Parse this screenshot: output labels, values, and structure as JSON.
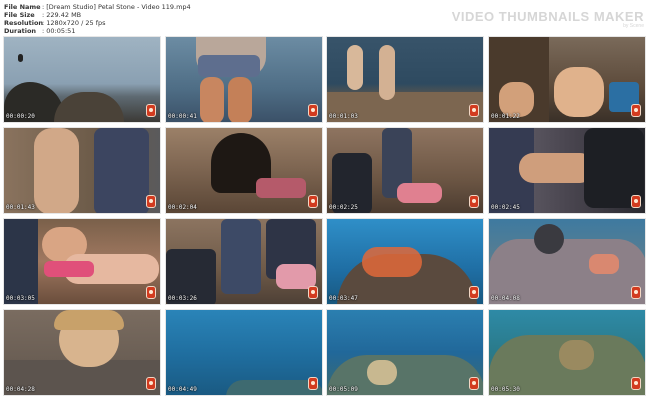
{
  "header": {
    "rows": [
      {
        "label": "File Name",
        "value": ": [Dream Studio] Petal Stone - Video 119.mp4"
      },
      {
        "label": "File Size",
        "value": ": 229.42 MB"
      },
      {
        "label": "Resolution",
        "value": ": 1280x720 / 25 fps"
      },
      {
        "label": "Duration",
        "value": ": 00:05:51"
      }
    ],
    "brand": "VIDEO THUMBNAILS MAKER",
    "brand_sub": "by Scene"
  },
  "thumbnails": [
    {
      "timestamp": "00:00:20",
      "scene": "rocky-shore-birds"
    },
    {
      "timestamp": "00:00:41",
      "scene": "person-standing-sea"
    },
    {
      "timestamp": "00:01:03",
      "scene": "two-people-rocks"
    },
    {
      "timestamp": "00:01:22",
      "scene": "people-in-cave"
    },
    {
      "timestamp": "00:01:43",
      "scene": "person-near-fins"
    },
    {
      "timestamp": "00:02:04",
      "scene": "cave-entrance"
    },
    {
      "timestamp": "00:02:25",
      "scene": "wetsuit-figures"
    },
    {
      "timestamp": "00:02:45",
      "scene": "wetsuit-closeup"
    },
    {
      "timestamp": "00:03:05",
      "scene": "face-on-towel"
    },
    {
      "timestamp": "00:03:26",
      "scene": "wetsuits-hanging"
    },
    {
      "timestamp": "00:03:47",
      "scene": "reef-orange-fish"
    },
    {
      "timestamp": "00:04:08",
      "scene": "coral-reef"
    },
    {
      "timestamp": "00:04:28",
      "scene": "smiling-girl"
    },
    {
      "timestamp": "00:04:49",
      "scene": "blue-water"
    },
    {
      "timestamp": "00:05:09",
      "scene": "reef-blue"
    },
    {
      "timestamp": "00:05:30",
      "scene": "reef-teal"
    }
  ]
}
